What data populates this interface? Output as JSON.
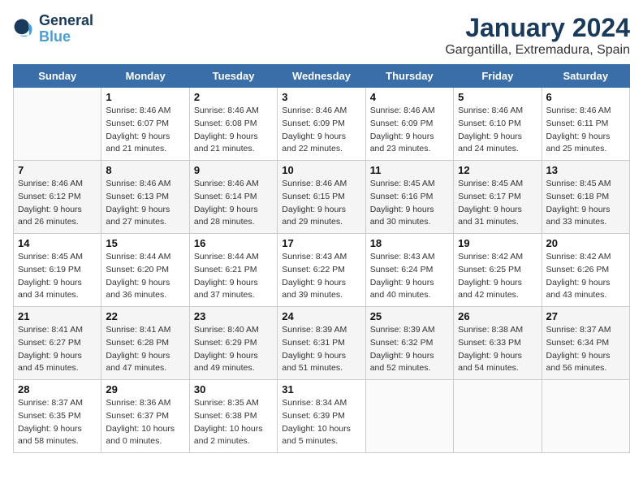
{
  "logo": {
    "line1": "General",
    "line2": "Blue"
  },
  "title": "January 2024",
  "subtitle": "Gargantilla, Extremadura, Spain",
  "weekdays": [
    "Sunday",
    "Monday",
    "Tuesday",
    "Wednesday",
    "Thursday",
    "Friday",
    "Saturday"
  ],
  "weeks": [
    [
      {
        "day": "",
        "sunrise": "",
        "sunset": "",
        "daylight": ""
      },
      {
        "day": "1",
        "sunrise": "Sunrise: 8:46 AM",
        "sunset": "Sunset: 6:07 PM",
        "daylight": "Daylight: 9 hours and 21 minutes."
      },
      {
        "day": "2",
        "sunrise": "Sunrise: 8:46 AM",
        "sunset": "Sunset: 6:08 PM",
        "daylight": "Daylight: 9 hours and 21 minutes."
      },
      {
        "day": "3",
        "sunrise": "Sunrise: 8:46 AM",
        "sunset": "Sunset: 6:09 PM",
        "daylight": "Daylight: 9 hours and 22 minutes."
      },
      {
        "day": "4",
        "sunrise": "Sunrise: 8:46 AM",
        "sunset": "Sunset: 6:09 PM",
        "daylight": "Daylight: 9 hours and 23 minutes."
      },
      {
        "day": "5",
        "sunrise": "Sunrise: 8:46 AM",
        "sunset": "Sunset: 6:10 PM",
        "daylight": "Daylight: 9 hours and 24 minutes."
      },
      {
        "day": "6",
        "sunrise": "Sunrise: 8:46 AM",
        "sunset": "Sunset: 6:11 PM",
        "daylight": "Daylight: 9 hours and 25 minutes."
      }
    ],
    [
      {
        "day": "7",
        "sunrise": "",
        "sunset": "",
        "daylight": ""
      },
      {
        "day": "8",
        "sunrise": "Sunrise: 8:46 AM",
        "sunset": "Sunset: 6:13 PM",
        "daylight": "Daylight: 9 hours and 27 minutes."
      },
      {
        "day": "9",
        "sunrise": "Sunrise: 8:46 AM",
        "sunset": "Sunset: 6:14 PM",
        "daylight": "Daylight: 9 hours and 28 minutes."
      },
      {
        "day": "10",
        "sunrise": "Sunrise: 8:46 AM",
        "sunset": "Sunset: 6:15 PM",
        "daylight": "Daylight: 9 hours and 29 minutes."
      },
      {
        "day": "11",
        "sunrise": "Sunrise: 8:45 AM",
        "sunset": "Sunset: 6:16 PM",
        "daylight": "Daylight: 9 hours and 30 minutes."
      },
      {
        "day": "12",
        "sunrise": "Sunrise: 8:45 AM",
        "sunset": "Sunset: 6:17 PM",
        "daylight": "Daylight: 9 hours and 31 minutes."
      },
      {
        "day": "13",
        "sunrise": "Sunrise: 8:45 AM",
        "sunset": "Sunset: 6:18 PM",
        "daylight": "Daylight: 9 hours and 33 minutes."
      }
    ],
    [
      {
        "day": "14",
        "sunrise": "",
        "sunset": "",
        "daylight": ""
      },
      {
        "day": "15",
        "sunrise": "Sunrise: 8:44 AM",
        "sunset": "Sunset: 6:20 PM",
        "daylight": "Daylight: 9 hours and 36 minutes."
      },
      {
        "day": "16",
        "sunrise": "Sunrise: 8:44 AM",
        "sunset": "Sunset: 6:21 PM",
        "daylight": "Daylight: 9 hours and 37 minutes."
      },
      {
        "day": "17",
        "sunrise": "Sunrise: 8:43 AM",
        "sunset": "Sunset: 6:22 PM",
        "daylight": "Daylight: 9 hours and 39 minutes."
      },
      {
        "day": "18",
        "sunrise": "Sunrise: 8:43 AM",
        "sunset": "Sunset: 6:24 PM",
        "daylight": "Daylight: 9 hours and 40 minutes."
      },
      {
        "day": "19",
        "sunrise": "Sunrise: 8:42 AM",
        "sunset": "Sunset: 6:25 PM",
        "daylight": "Daylight: 9 hours and 42 minutes."
      },
      {
        "day": "20",
        "sunrise": "Sunrise: 8:42 AM",
        "sunset": "Sunset: 6:26 PM",
        "daylight": "Daylight: 9 hours and 43 minutes."
      }
    ],
    [
      {
        "day": "21",
        "sunrise": "",
        "sunset": "",
        "daylight": ""
      },
      {
        "day": "22",
        "sunrise": "Sunrise: 8:41 AM",
        "sunset": "Sunset: 6:28 PM",
        "daylight": "Daylight: 9 hours and 47 minutes."
      },
      {
        "day": "23",
        "sunrise": "Sunrise: 8:40 AM",
        "sunset": "Sunset: 6:29 PM",
        "daylight": "Daylight: 9 hours and 49 minutes."
      },
      {
        "day": "24",
        "sunrise": "Sunrise: 8:39 AM",
        "sunset": "Sunset: 6:31 PM",
        "daylight": "Daylight: 9 hours and 51 minutes."
      },
      {
        "day": "25",
        "sunrise": "Sunrise: 8:39 AM",
        "sunset": "Sunset: 6:32 PM",
        "daylight": "Daylight: 9 hours and 52 minutes."
      },
      {
        "day": "26",
        "sunrise": "Sunrise: 8:38 AM",
        "sunset": "Sunset: 6:33 PM",
        "daylight": "Daylight: 9 hours and 54 minutes."
      },
      {
        "day": "27",
        "sunrise": "Sunrise: 8:37 AM",
        "sunset": "Sunset: 6:34 PM",
        "daylight": "Daylight: 9 hours and 56 minutes."
      }
    ],
    [
      {
        "day": "28",
        "sunrise": "",
        "sunset": "",
        "daylight": ""
      },
      {
        "day": "29",
        "sunrise": "Sunrise: 8:36 AM",
        "sunset": "Sunset: 6:37 PM",
        "daylight": "Daylight: 10 hours and 0 minutes."
      },
      {
        "day": "30",
        "sunrise": "Sunrise: 8:35 AM",
        "sunset": "Sunset: 6:38 PM",
        "daylight": "Daylight: 10 hours and 2 minutes."
      },
      {
        "day": "31",
        "sunrise": "Sunrise: 8:34 AM",
        "sunset": "Sunset: 6:39 PM",
        "daylight": "Daylight: 10 hours and 5 minutes."
      },
      {
        "day": "",
        "sunrise": "",
        "sunset": "",
        "daylight": ""
      },
      {
        "day": "",
        "sunrise": "",
        "sunset": "",
        "daylight": ""
      },
      {
        "day": "",
        "sunrise": "",
        "sunset": "",
        "daylight": ""
      }
    ]
  ],
  "week1_sunday": {
    "sunrise": "Sunrise: 8:46 AM",
    "sunset": "Sunset: 6:12 PM",
    "daylight": "Daylight: 9 hours and 26 minutes."
  },
  "week2_sunday": {
    "sunrise": "Sunrise: 8:45 AM",
    "sunset": "Sunset: 6:19 PM",
    "daylight": "Daylight: 9 hours and 34 minutes."
  },
  "week3_sunday": {
    "sunrise": "Sunrise: 8:41 AM",
    "sunset": "Sunset: 6:27 PM",
    "daylight": "Daylight: 9 hours and 45 minutes."
  },
  "week4_sunday": {
    "sunrise": "Sunrise: 8:37 AM",
    "sunset": "Sunset: 6:35 PM",
    "daylight": "Daylight: 9 hours and 58 minutes."
  }
}
